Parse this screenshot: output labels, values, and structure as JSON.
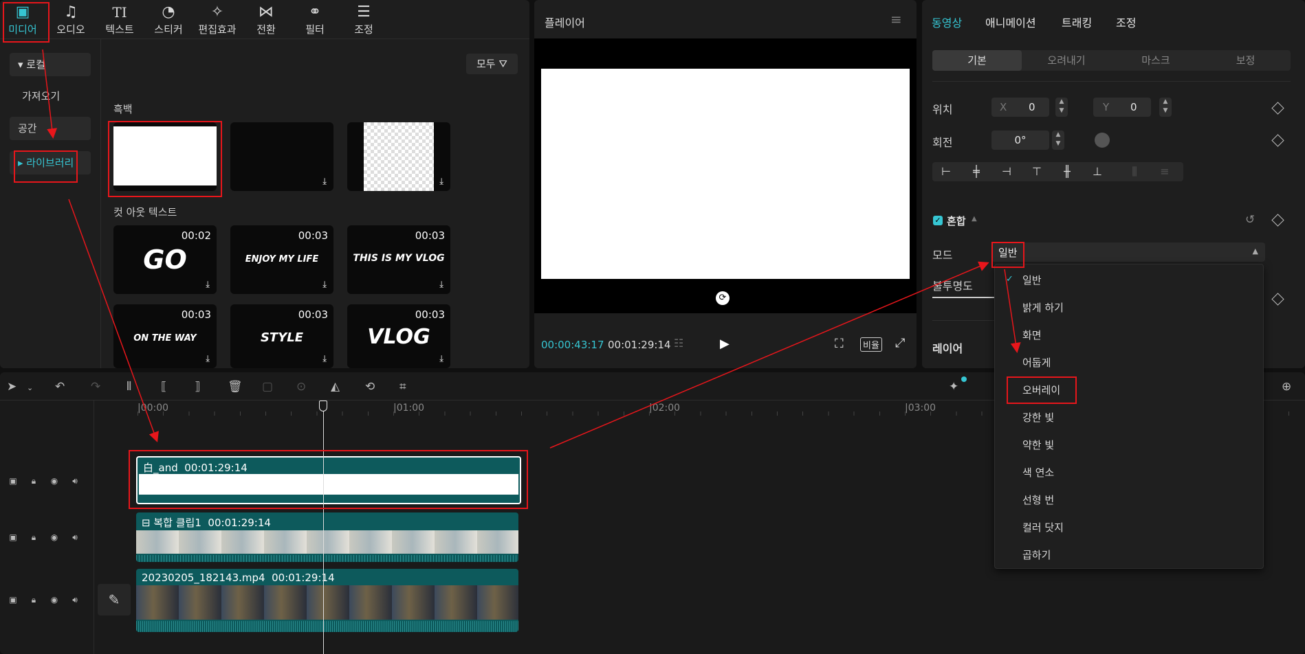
{
  "toolbar": {
    "items": [
      {
        "label": "미디어",
        "icon": "media-icon",
        "glyph": "▣"
      },
      {
        "label": "오디오",
        "icon": "audio-icon",
        "glyph": "♫"
      },
      {
        "label": "텍스트",
        "icon": "text-icon",
        "glyph": "TI"
      },
      {
        "label": "스티커",
        "icon": "sticker-icon",
        "glyph": "◔"
      },
      {
        "label": "편집효과",
        "icon": "effects-icon",
        "glyph": "✧"
      },
      {
        "label": "전환",
        "icon": "transition-icon",
        "glyph": "⋈"
      },
      {
        "label": "필터",
        "icon": "filter-icon",
        "glyph": "⚭"
      },
      {
        "label": "조정",
        "icon": "adjust-icon",
        "glyph": "☰"
      }
    ]
  },
  "sidebar": {
    "local": "▾ 로컬",
    "import": "가져오기",
    "space": "공간",
    "library": "▸ 라이브러리"
  },
  "library": {
    "filter_label": "모두",
    "section_bw": "흑백",
    "section_cutout": "컷 아웃 텍스트",
    "cutout_items": [
      {
        "dur": "00:02",
        "text": "GO"
      },
      {
        "dur": "00:03",
        "text": "ENJOY MY LIFE"
      },
      {
        "dur": "00:03",
        "text": "THIS IS MY VLOG"
      },
      {
        "dur": "00:03",
        "text": "ON THE WAY"
      },
      {
        "dur": "00:03",
        "text": "STYLE"
      },
      {
        "dur": "00:03",
        "text": "VLOG"
      }
    ]
  },
  "player": {
    "title": "플레이어",
    "current_time": "00:00:43:17",
    "total_time": "00:01:29:14",
    "ratio_label": "비율"
  },
  "inspector": {
    "tabs": [
      "동영상",
      "애니메이션",
      "트래킹",
      "조정"
    ],
    "subtabs": [
      "기본",
      "오려내기",
      "마스크",
      "보정"
    ],
    "position_label": "위치",
    "x_label": "X",
    "x_value": "0",
    "y_label": "Y",
    "y_value": "0",
    "rotation_label": "회전",
    "rotation_value": "0°",
    "blend_label": "혼합",
    "mode_label": "모드",
    "mode_value": "일반",
    "opacity_label": "불투명도",
    "layer_label": "레이어"
  },
  "dropdown": {
    "options": [
      "일반",
      "밝게 하기",
      "화면",
      "어둡게",
      "오버레이",
      "강한 빛",
      "약한 빛",
      "색 연소",
      "선형 번",
      "컬러 닷지",
      "곱하기"
    ],
    "selected": "일반"
  },
  "timeline": {
    "ruler": [
      "|00:00",
      "|01:00",
      "|02:00",
      "|03:00"
    ],
    "clips": [
      {
        "label": "白_and",
        "dur": "00:01:29:14"
      },
      {
        "label": "복합 클립1",
        "dur": "00:01:29:14"
      },
      {
        "label": "20230205_182143.mp4",
        "dur": "00:01:29:14"
      }
    ]
  },
  "colors": {
    "accent": "#36c6d3",
    "annotation": "#e8161b",
    "clip": "#0d5a5c"
  }
}
